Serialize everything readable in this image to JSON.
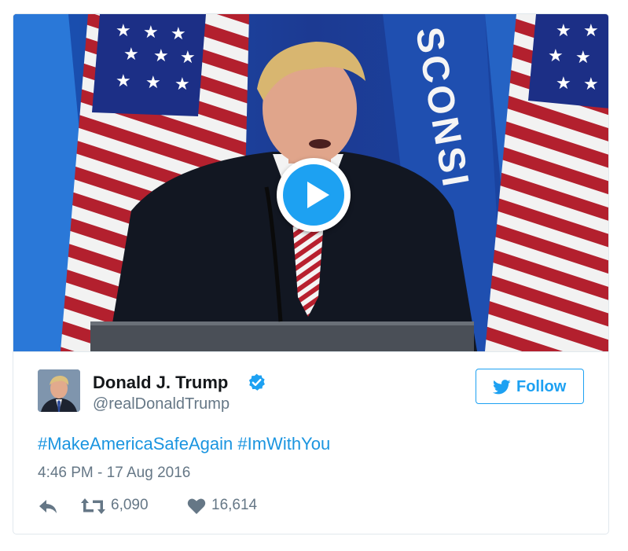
{
  "tweet": {
    "author": {
      "name": "Donald J. Trump",
      "handle": "@realDonaldTrump",
      "avatar_icon": "profile-photo",
      "verified_icon": "verified-badge-icon"
    },
    "follow_label": "Follow",
    "hashtags": [
      "#MakeAmericaSafeAgain",
      "#ImWithYou"
    ],
    "timestamp": "4:46 PM - 17 Aug 2016",
    "actions": {
      "reply_icon": "reply-icon",
      "retweet_icon": "retweet-icon",
      "retweet_count": "6,090",
      "like_icon": "heart-icon",
      "like_count": "16,614"
    },
    "media": {
      "type": "video",
      "play_icon": "play-icon",
      "scene_text": "SCONSI"
    }
  },
  "colors": {
    "accent": "#1da1f2",
    "link": "#1b95e0",
    "text": "#14171a",
    "secondary": "#657786",
    "border": "#e1e8ed"
  }
}
